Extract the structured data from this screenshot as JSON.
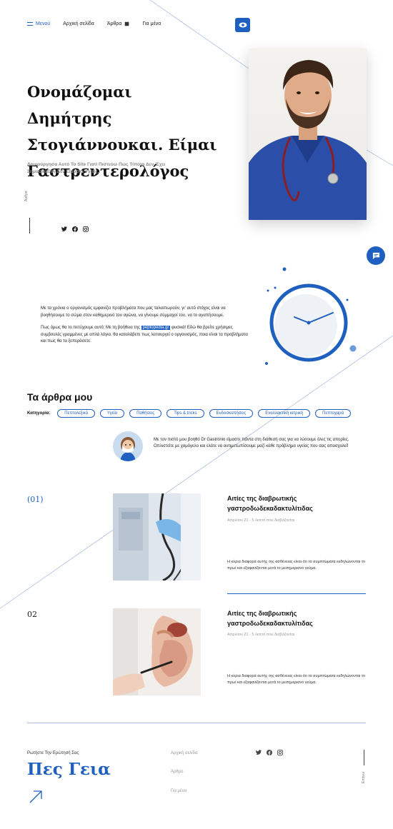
{
  "nav": {
    "menu_label": "Μενού",
    "home_label": "Αρχική σελίδα",
    "articles_label": "Άρθρα",
    "about_label": "Για μένα"
  },
  "hero": {
    "title": "Ονομάζομαι Δημήτρης Στογιάννουκαι. Είμαι Γαστρεντερολόγος",
    "subtitle": "Δημιούργησα Αυτό Το Site Γιατί Πιστεύω Πως Τίποτα Δεν Έχει Σημασία Εάν Δεν Είμαστε Υγιείς.",
    "side_label": "Άρθρα"
  },
  "intro": {
    "p1": "Με τα χρόνια ο οργανισμός εμφανίζει προβλήματα που μας ταλαιπωρούν, γι' αυτό στόχος είναι να βοηθήσουμε το σώμα στον καθημερινό του αγώνα, να γίνουμε σύμμαχοί του, να το αγαπήσουμε.",
    "p2_before": "Πως όμως θα το πετύχουμε αυτό; Με τη βοήθεια της ",
    "p2_highlight": "peptopedia.gr",
    "p2_after": " φυσικά! Εδώ θα βρείτε χρήσιμες συμβουλές γραμμένες με απλά λόγια. θα καταλάβετε πως λειτουργεί ο οργανισμός, ποια είναι τα προβλήματα και πως θα τα ξεπεράσετε."
  },
  "articles": {
    "title": "Τα άρθρα μου",
    "category_label": "Κατηγορία:",
    "categories": [
      "Πεπτολεξικό",
      "Υγεία",
      "Παθήσεις",
      "Tips & tricks",
      "Ενδοσκοπήσεις",
      "Εναλλακτική ιατρική",
      "Πεπτοχαρά"
    ],
    "assistant_text": "Με τον πιστό μου βοηθό Dr Gastronio είμαστε πάντα στη διάθεσή σας για να λύσουμε όλες τις απορίες. Οπλιστείτε με χαμόγελο και ελάτε να αντιμετωπίσουμε μαζί κάθε πρόβλημα υγείας που σας απασχολεί!",
    "items": [
      {
        "number": "(01)",
        "title": "Αιτίες της διαβρωτικής γαστροδωδεκαδακτυλίτιδας",
        "meta": "Απριλίου 21 · 5 λεπτά που διαβάζονται",
        "desc": "Η κύρια διαφορά αυτής της ασθένειας είναι ότι τα συμπτώματα εκδηλώνονται το πρωί και εξαφανίζονται μετά το μεσημεριανό γεύμα."
      },
      {
        "number": "02",
        "title": "Αιτίες της διαβρωτικής γαστροδωδεκαδακτυλίτιδας",
        "meta": "Απριλίου 21 · 5 λεπτά που διαβάζονται",
        "desc": "Η κύρια διαφορά αυτής της ασθένειας είναι ότι τα συμπτώματα εκδηλώνονται το πρωί και εξαφανίζονται μετά το μεσημεριανό γεύμα."
      }
    ]
  },
  "footer": {
    "ask_label": "Ρωτήστε Την Ερώτησή Σας",
    "hello": "Πες Γεια",
    "links": [
      "Αρχική σελίδα",
      "Άρθρο",
      "Για μένα"
    ],
    "up_label": "Επάνω"
  },
  "colors": {
    "accent": "#1f5fbf"
  },
  "icons": [
    "hamburger-icon",
    "book-icon",
    "eye-icon",
    "twitter-icon",
    "facebook-icon",
    "instagram-icon",
    "chat-icon",
    "arrow-up-right-icon"
  ]
}
